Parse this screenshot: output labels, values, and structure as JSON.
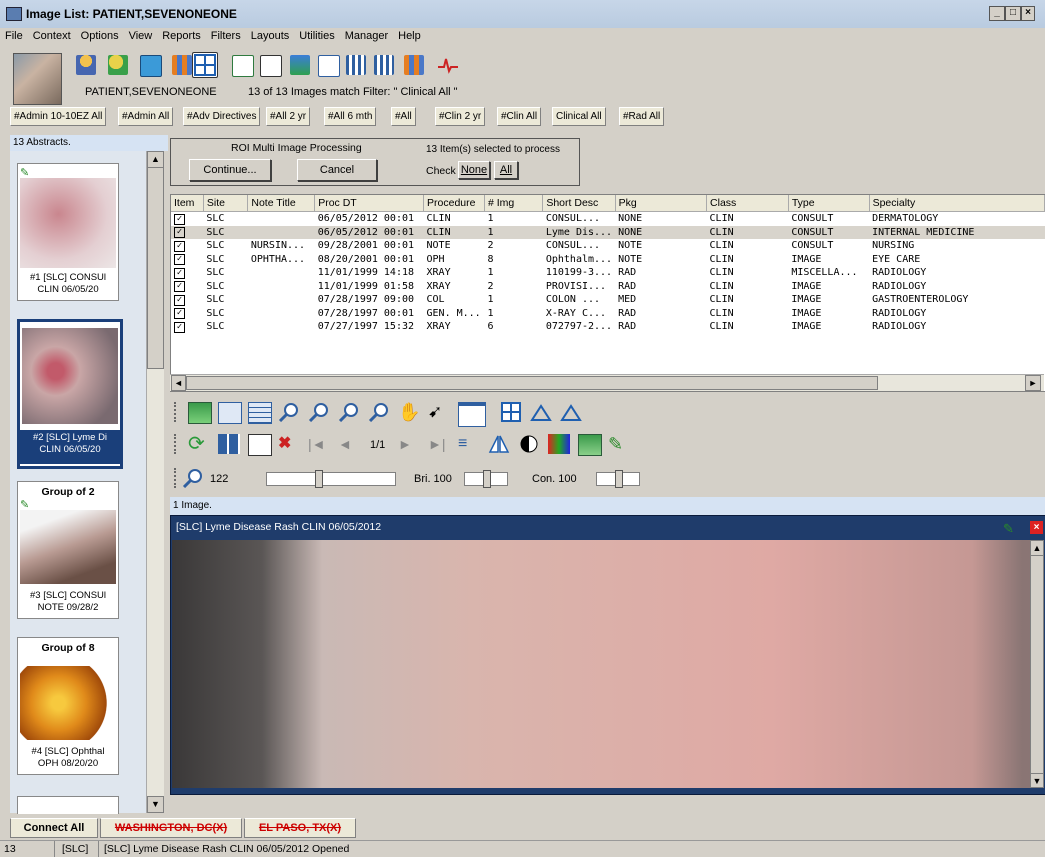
{
  "window": {
    "title": "Image List: PATIENT,SEVENONEONE"
  },
  "menu": [
    "File",
    "Context",
    "Options",
    "View",
    "Reports",
    "Filters",
    "Layouts",
    "Utilities",
    "Manager",
    "Help"
  ],
  "patient": {
    "name": "PATIENT,SEVENONEONE",
    "filter_info": "13 of 13 Images match Filter: \" Clinical All \""
  },
  "filters": [
    "#Admin 10-10EZ All",
    "#Admin All",
    "#Adv Directives",
    "#All 2 yr",
    "#All 6 mth",
    "#All",
    "#Clin 2 yr",
    "#Clin All",
    "Clinical All",
    "#Rad All"
  ],
  "left_panel": {
    "header": "13 Abstracts.",
    "thumbs": [
      {
        "group": "",
        "line1": "#1 [SLC] CONSUl",
        "line2": "CLIN 06/05/20"
      },
      {
        "group": "",
        "line1": "#2 [SLC] Lyme Di",
        "line2": "CLIN 06/05/20"
      },
      {
        "group": "Group of 2",
        "line1": "#3 [SLC] CONSUl",
        "line2": "NOTE 09/28/2"
      },
      {
        "group": "Group of 8",
        "line1": "#4 [SLC] Ophthal",
        "line2": "OPH 08/20/20"
      }
    ]
  },
  "roi": {
    "title": "ROI Multi Image Processing",
    "continue": "Continue...",
    "cancel": "Cancel",
    "selected": "13 Item(s) selected to process",
    "check_label": "Check",
    "none": "None",
    "all": "All"
  },
  "table": {
    "columns": [
      "Item",
      "Site",
      "Note Title",
      "Proc DT",
      "Procedure",
      "# Img",
      "Short Desc",
      "Pkg",
      "Class",
      "Type",
      "Specialty"
    ],
    "rows": [
      [
        "SLC",
        "",
        "06/05/2012 00:01",
        "CLIN",
        "1",
        "CONSUL...",
        "NONE",
        "CLIN",
        "CONSULT",
        "DERMATOLOGY"
      ],
      [
        "SLC",
        "",
        "06/05/2012 00:01",
        "CLIN",
        "1",
        "Lyme Dis...",
        "NONE",
        "CLIN",
        "CONSULT",
        "INTERNAL MEDICINE"
      ],
      [
        "SLC",
        "NURSIN...",
        "09/28/2001 00:01",
        "NOTE",
        "2",
        "CONSUL...",
        "NOTE",
        "CLIN",
        "CONSULT",
        "NURSING"
      ],
      [
        "SLC",
        "OPHTHA...",
        "08/20/2001 00:01",
        "OPH",
        "8",
        "Ophthalm...",
        "NOTE",
        "CLIN",
        "IMAGE",
        "EYE CARE"
      ],
      [
        "SLC",
        "",
        "11/01/1999 14:18",
        "XRAY",
        "1",
        "110199-3...",
        "RAD",
        "CLIN",
        "MISCELLA...",
        "RADIOLOGY"
      ],
      [
        "SLC",
        "",
        "11/01/1999 01:58",
        "XRAY",
        "2",
        "PROVISI...",
        "RAD",
        "CLIN",
        "IMAGE",
        "RADIOLOGY"
      ],
      [
        "SLC",
        "",
        "07/28/1997 09:00",
        "COL",
        "1",
        "COLON ...",
        "MED",
        "CLIN",
        "IMAGE",
        "GASTROENTEROLOGY"
      ],
      [
        "SLC",
        "",
        "07/28/1997 00:01",
        "GEN. M...",
        "1",
        "X-RAY C...",
        "RAD",
        "CLIN",
        "IMAGE",
        "RADIOLOGY"
      ],
      [
        "SLC",
        "",
        "07/27/1997 15:32",
        "XRAY",
        "6",
        "072797-2...",
        "RAD",
        "CLIN",
        "IMAGE",
        "RADIOLOGY"
      ]
    ]
  },
  "image_toolbar": {
    "page": "1/1",
    "zoom": "122",
    "bri_label": "Bri. 100",
    "con_label": "Con. 100"
  },
  "viewer": {
    "header": "1 Image.",
    "caption": "[SLC] Lyme Disease Rash CLIN 06/05/2012"
  },
  "tabs": {
    "connect_all": "Connect All",
    "site1": "WASHINGTON, DC(X)",
    "site2": "EL PASO, TX(X)"
  },
  "status": {
    "count": "13",
    "site": "[SLC]",
    "message": "[SLC] Lyme Disease Rash CLIN 06/05/2012  Opened"
  },
  "colors": {
    "title_bg": "#c7d6e8",
    "viewer_bg": "#1f3c6b",
    "site_disconnected": "#cc0000"
  }
}
